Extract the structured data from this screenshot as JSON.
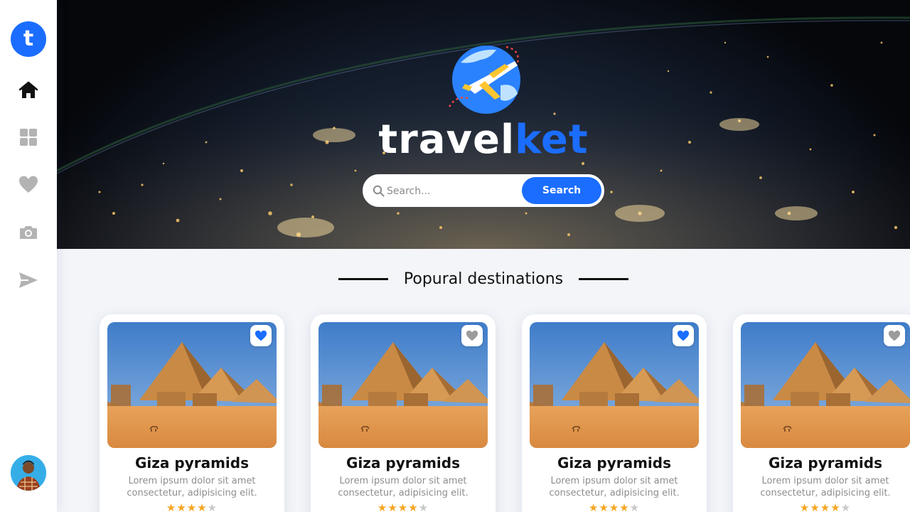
{
  "sidebar": {
    "logo_letter": "t",
    "items": [
      {
        "name": "home",
        "icon": "home-icon",
        "active": true
      },
      {
        "name": "grid",
        "icon": "grid-icon",
        "active": false
      },
      {
        "name": "favorites",
        "icon": "heart-icon",
        "active": false
      },
      {
        "name": "camera",
        "icon": "camera-icon",
        "active": false
      },
      {
        "name": "send",
        "icon": "send-icon",
        "active": false
      }
    ],
    "avatar_icon": "user-avatar"
  },
  "hero": {
    "brand_part1": "travel",
    "brand_part2": "ket",
    "search_placeholder": "Search...",
    "search_button_label": "Search"
  },
  "section": {
    "title": "Popural destinations"
  },
  "cards": [
    {
      "title": "Giza pyramids",
      "description": "Lorem ipsum dolor sit amet consectetur, adipisicing elit.",
      "rating": 4,
      "max_rating": 5,
      "favorited": true
    },
    {
      "title": "Giza pyramids",
      "description": "Lorem ipsum dolor sit amet consectetur, adipisicing elit.",
      "rating": 4,
      "max_rating": 5,
      "favorited": false
    },
    {
      "title": "Giza pyramids",
      "description": "Lorem ipsum dolor sit amet consectetur, adipisicing elit.",
      "rating": 4,
      "max_rating": 5,
      "favorited": true
    },
    {
      "title": "Giza pyramids",
      "description": "Lorem ipsum dolor sit amet consectetur, adipisicing elit.",
      "rating": 4,
      "max_rating": 5,
      "favorited": false
    }
  ],
  "colors": {
    "accent": "#1b6dff",
    "star_active": "#f5a623",
    "star_inactive": "#c9c9c9",
    "icon_inactive": "#b3b3b3",
    "icon_active": "#111111"
  }
}
